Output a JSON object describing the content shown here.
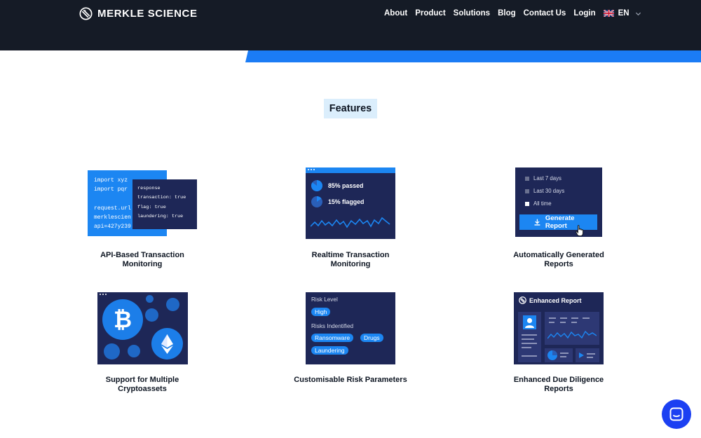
{
  "nav": {
    "brand": "MERKLE SCIENCE",
    "links": [
      "About",
      "Product",
      "Solutions",
      "Blog",
      "Contact Us",
      "Login"
    ],
    "language": "EN"
  },
  "page_title": "Features",
  "features": [
    {
      "label": "API-Based Transaction Monitoring",
      "code_main": "import xyz\nimport pqr\n\nrequest.url\nmerklescien\napi=427y239",
      "code_response": "response\ntransaction: true\nflag: true\nlaundering: true"
    },
    {
      "label": "Realtime Transaction Monitoring",
      "passed_text": "85% passed",
      "flagged_text": "15% flagged",
      "passed_pct": 85,
      "flagged_pct": 15
    },
    {
      "label": "Automatically Generated Reports",
      "options": [
        "Last 7 days",
        "Last 30 days",
        "All time"
      ],
      "selected_option": "All time",
      "button": "Generate Report"
    },
    {
      "label": "Support for Multiple Cryptoassets",
      "icons": [
        "bitcoin-icon",
        "ethereum-icon"
      ]
    },
    {
      "label": "Customisable Risk Parameters",
      "risk_level_title": "Risk Level",
      "risk_level_value": "High",
      "risks_title": "Risks Indentified",
      "risks": [
        "Ransomware",
        "Drugs",
        "Laundering"
      ]
    },
    {
      "label": "Enhanced Due Diligence Reports",
      "card_title": "Enhanced Report"
    }
  ],
  "colors": {
    "nav_bg": "#151b26",
    "accent": "#1c86f2",
    "card_dark": "#1e2757",
    "title_bg": "#dbeefc",
    "chat": "#1c40f2"
  }
}
